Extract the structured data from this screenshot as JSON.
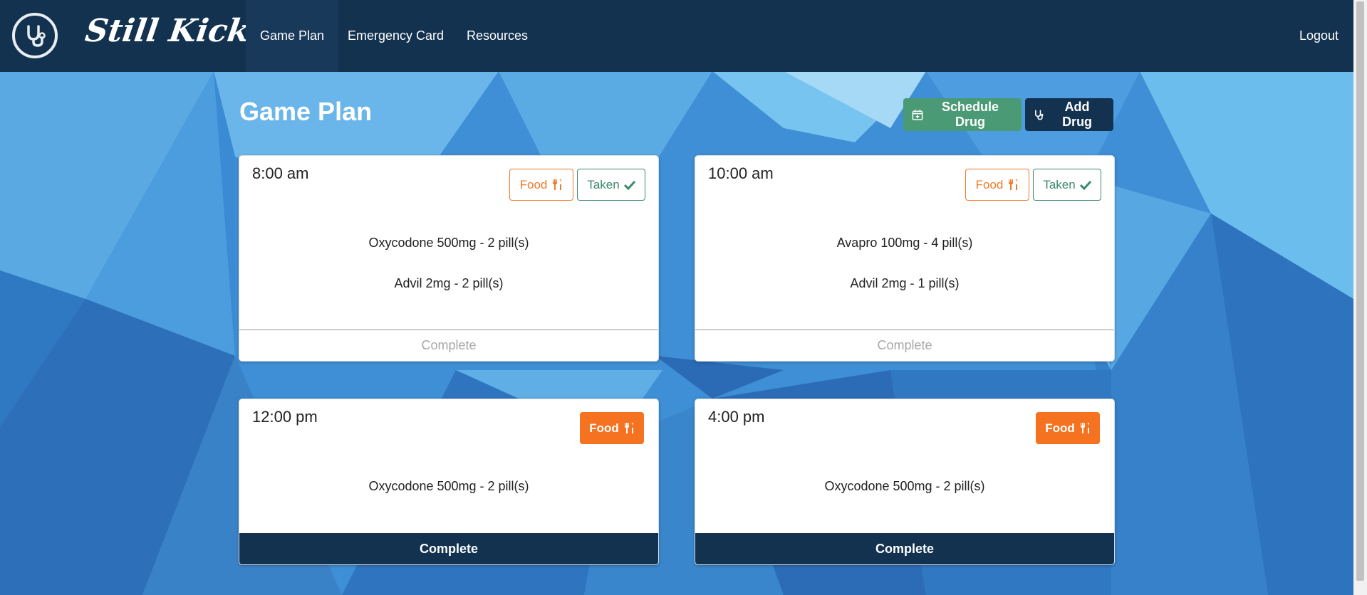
{
  "nav": {
    "brand": "Still Kicking",
    "items": [
      {
        "label": "Game Plan"
      },
      {
        "label": "Emergency Card"
      },
      {
        "label": "Resources"
      }
    ],
    "logout": "Logout"
  },
  "page": {
    "title": "Game Plan",
    "schedule_button": "Schedule Drug",
    "add_button": "Add Drug"
  },
  "cards": [
    {
      "time": "8:00 am",
      "food": "Food",
      "taken": "Taken",
      "drugs": [
        "Oxycodone 500mg - 2 pill(s)",
        "Advil 2mg - 2 pill(s)"
      ],
      "complete": "Complete"
    },
    {
      "time": "10:00 am",
      "food": "Food",
      "taken": "Taken",
      "drugs": [
        "Avapro 100mg - 4 pill(s)",
        "Advil 2mg - 1 pill(s)"
      ],
      "complete": "Complete"
    },
    {
      "time": "12:00 pm",
      "food": "Food",
      "drugs": [
        "Oxycodone 500mg - 2 pill(s)"
      ],
      "complete": "Complete"
    },
    {
      "time": "4:00 pm",
      "food": "Food",
      "drugs": [
        "Oxycodone 500mg - 2 pill(s)"
      ],
      "complete": "Complete"
    }
  ],
  "colors": {
    "navbar": "#123250",
    "food_orange": "#f47220",
    "taken_green": "#3d8a6a",
    "schedule_green": "#4a9a76"
  },
  "icons": {
    "logo": "stethoscope-icon",
    "schedule": "calendar-plus-icon",
    "add": "stethoscope-icon",
    "food": "utensils-icon",
    "taken": "check-icon"
  }
}
